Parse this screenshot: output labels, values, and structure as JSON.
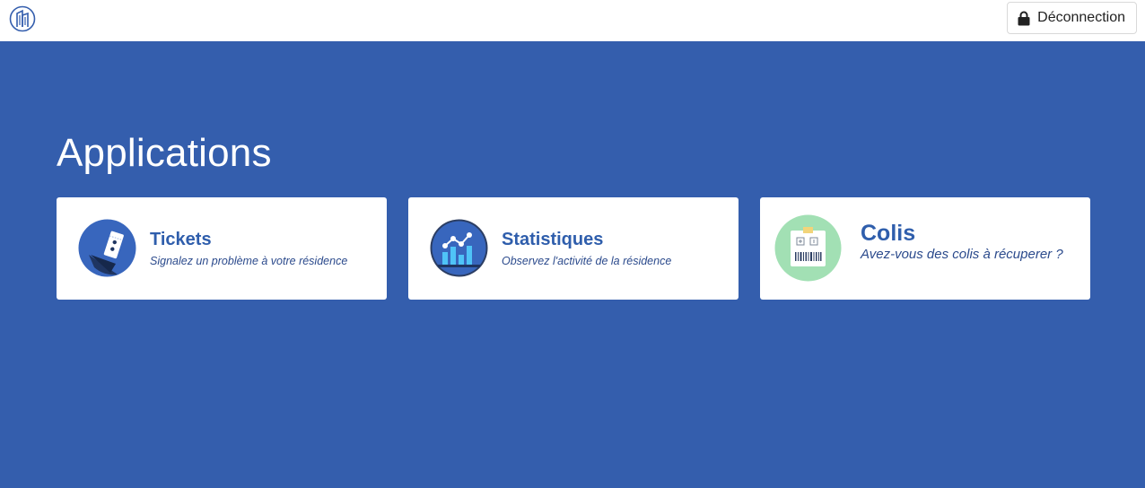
{
  "header": {
    "logo_icon": "building-logo-icon",
    "logout_icon": "lock-icon",
    "logout_label": "Déconnection"
  },
  "main": {
    "heading": "Applications",
    "cards": [
      {
        "title": "Tickets",
        "description": "Signalez un problème à votre résidence",
        "icon": "ticket-icon"
      },
      {
        "title": "Statistiques",
        "description": "Observez l'activité de la résidence",
        "icon": "statistics-chart-icon"
      },
      {
        "title": "Colis",
        "description": "Avez-vous des colis à récuperer ?",
        "icon": "package-icon"
      }
    ]
  },
  "colors": {
    "background": "#345ead",
    "card_title": "#2f5eac",
    "card_description": "#2b4a8c",
    "header_background": "#ffffff"
  }
}
